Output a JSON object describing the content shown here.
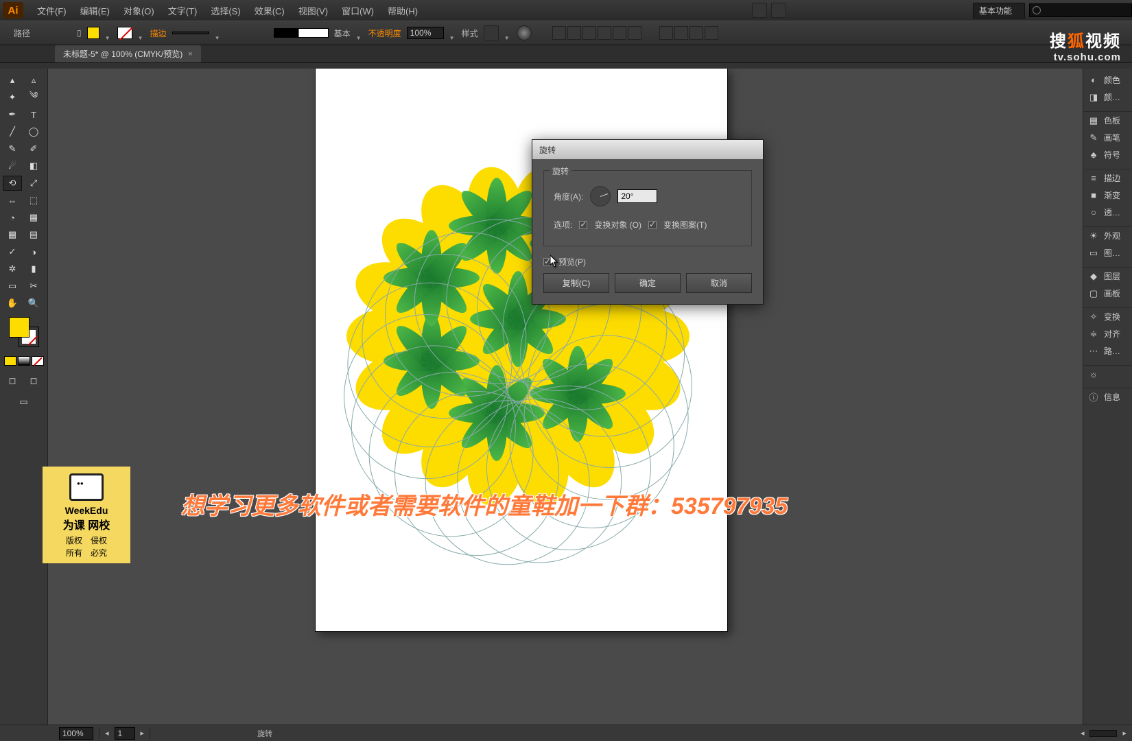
{
  "menubar": {
    "items": [
      "文件(F)",
      "编辑(E)",
      "对象(O)",
      "文字(T)",
      "选择(S)",
      "效果(C)",
      "视图(V)",
      "窗口(W)",
      "帮助(H)"
    ],
    "workspace": "基本功能"
  },
  "optbar": {
    "label": "路径",
    "stroke_label": "描边",
    "profile_label": "基本",
    "opacity_label": "不透明度",
    "opacity_value": "100%",
    "style_label": "样式"
  },
  "doctab": {
    "name": "未标题-5* @ 100% (CMYK/预览)"
  },
  "dialog": {
    "title": "旋转",
    "box_title": "旋转",
    "angle_label": "角度(A):",
    "angle_value": "20°",
    "options_label": "选项:",
    "opt_objects": "变换对象 (O)",
    "opt_patterns": "变换图案(T)",
    "preview_label": "预览(P)",
    "btn_copy": "复制(C)",
    "btn_ok": "确定",
    "btn_cancel": "取消"
  },
  "rightdock": [
    "颜色",
    "颜…",
    "色板",
    "画笔",
    "符号",
    "描边",
    "渐变",
    "透…",
    "外观",
    "图…",
    "图层",
    "画板",
    "变换",
    "对齐",
    "路…",
    "",
    "信息"
  ],
  "status": {
    "zoom": "100%",
    "page": "1",
    "tool": "旋转"
  },
  "overlay": {
    "text": "想学习更多软件或者需要软件的童鞋加一下群：535797935",
    "badge_l1": "WeekEdu",
    "badge_l2": "为课 网校",
    "badge_l3": "版权　侵权",
    "badge_l4": "所有　必究"
  },
  "sohu": {
    "l2": "tv.sohu.com"
  }
}
